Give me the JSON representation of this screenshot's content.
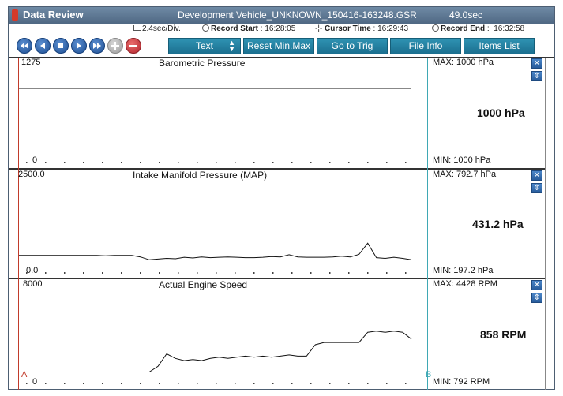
{
  "window": {
    "app_title": "Data Review",
    "file_name": "Development Vehicle_UNKNOWN_150416-163248.GSR",
    "duration": "49.0sec"
  },
  "infobar": {
    "time_div": "2.4sec/Div.",
    "record_start_label": "Record Start",
    "record_start_value": "16:28:05",
    "cursor_time_label": "Cursor Time",
    "cursor_time_value": "16:29:43",
    "record_end_label": "Record End",
    "record_end_value": "16:32:58"
  },
  "toolbar": {
    "nav_icons": [
      "skip-to-start-icon",
      "previous-icon",
      "stop-icon",
      "next-icon",
      "skip-to-end-icon",
      "add-icon",
      "remove-icon"
    ],
    "text_button": "Text",
    "reset_button": "Reset Min.Max",
    "trig_button": "Go to Trig",
    "file_info_button": "File Info",
    "items_list_button": "Items List"
  },
  "markers": {
    "a": "A",
    "b": "B"
  },
  "colors": {
    "titlebar": "#5a748f",
    "toolbar_button": "#1f7fa0",
    "marker_a": "#c13b2b",
    "marker_b": "#3fa8b4"
  },
  "chart_data": [
    {
      "type": "line",
      "title": "Barometric Pressure",
      "ylim": [
        0,
        1275
      ],
      "y_max_label": "1275",
      "y_min_label": "0",
      "max_text": "MAX:  1000 hPa",
      "min_text": "MIN:  1000 hPa",
      "current_value": "1000 hPa",
      "values": [
        1000,
        1000
      ]
    },
    {
      "type": "line",
      "title": "Intake Manifold Pressure (MAP)",
      "ylim": [
        0,
        2500
      ],
      "y_max_label": "2500.0",
      "y_min_label": "0.0",
      "max_text": "MAX: 792.7 hPa",
      "min_text": "MIN: 197.2 hPa",
      "current_value": "431.2 hPa",
      "values": [
        420,
        420,
        420,
        420,
        420,
        420,
        420,
        420,
        420,
        420,
        410,
        420,
        420,
        420,
        380,
        300,
        320,
        340,
        330,
        370,
        350,
        380,
        360,
        370,
        380,
        370,
        360,
        360,
        370,
        390,
        380,
        440,
        380,
        370,
        370,
        370,
        380,
        400,
        380,
        450,
        760,
        360,
        340,
        370,
        340,
        300
      ]
    },
    {
      "type": "line",
      "title": "Actual Engine Speed",
      "ylim": [
        0,
        8000
      ],
      "y_max_label": "8000",
      "y_min_label": "0",
      "max_text": "MAX:  4428 RPM",
      "min_text": "MIN:   792 RPM",
      "current_value": "858 RPM",
      "values": [
        800,
        800,
        800,
        800,
        800,
        800,
        800,
        800,
        800,
        800,
        800,
        800,
        800,
        800,
        800,
        800,
        1300,
        2400,
        2000,
        1800,
        1900,
        1800,
        2000,
        2100,
        2000,
        2100,
        2200,
        2100,
        2200,
        2100,
        2200,
        2300,
        2200,
        2200,
        3200,
        3400,
        3400,
        3400,
        3400,
        3400,
        4300,
        4400,
        4300,
        4400,
        4300,
        3700
      ]
    }
  ]
}
